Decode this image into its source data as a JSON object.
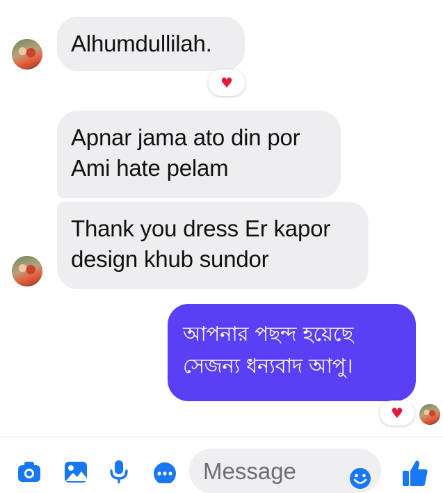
{
  "conversation": {
    "messages": [
      {
        "direction": "incoming",
        "lines": [
          "Alhumdullilah."
        ],
        "reaction": "♥"
      },
      {
        "direction": "incoming",
        "lines": [
          "Apnar jama ato din por",
          "Ami hate pelam"
        ]
      },
      {
        "direction": "incoming",
        "lines": [
          "Thank you dress Er kapor",
          "design khub sundor"
        ]
      },
      {
        "direction": "outgoing",
        "lines": [
          "আপনার পছন্দ হয়েছে",
          "সেজন্য ধন্যবাদ আপু।"
        ],
        "reaction": "♥"
      }
    ]
  },
  "composer": {
    "placeholder": "Message",
    "icons": [
      "camera-icon",
      "gallery-icon",
      "microphone-icon",
      "more-icon",
      "emoji-icon",
      "thumbs-up-icon"
    ]
  },
  "colors": {
    "incoming_bubble": "#eeeef0",
    "outgoing_bubble": "#5b3ff5",
    "accent": "#1877f2",
    "reaction": "#e3183a"
  }
}
